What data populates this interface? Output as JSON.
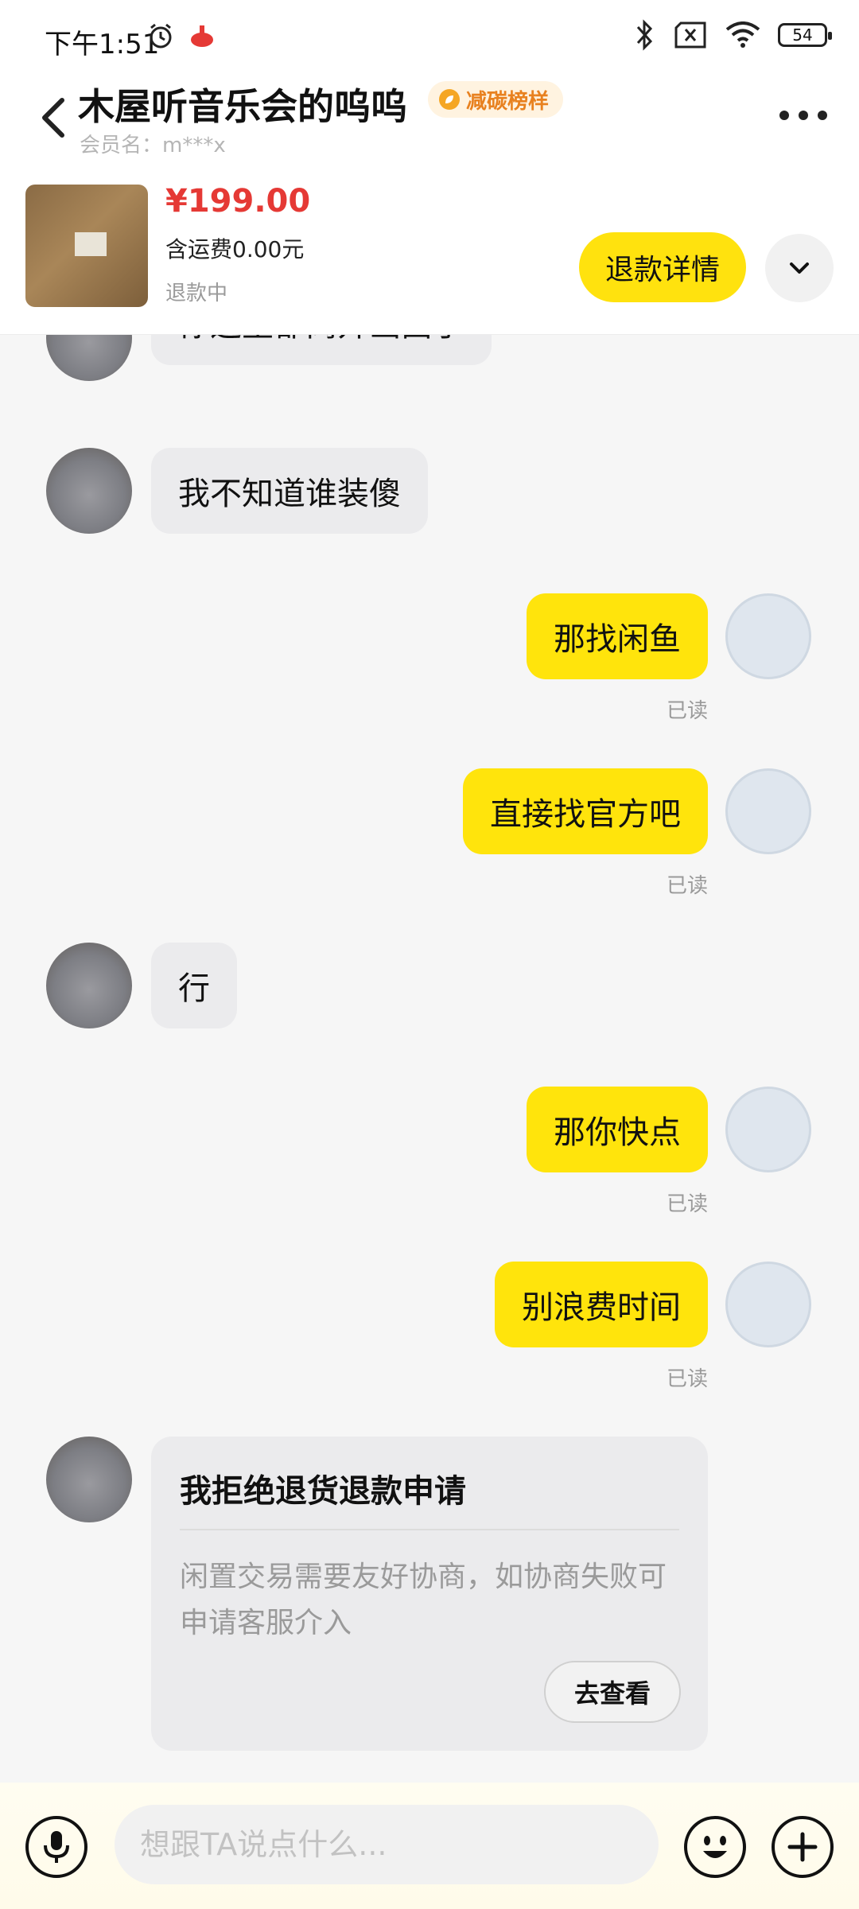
{
  "status_bar": {
    "time": "下午1:51",
    "battery": "54"
  },
  "header": {
    "seller_name": "木屋听音乐会的呜呜",
    "tag": "减碳榜样",
    "member_name": "会员名：m***x"
  },
  "order": {
    "price": "¥199.00",
    "shipping": "含运费0.00元",
    "status": "退款中",
    "refund_detail_button": "退款详情"
  },
  "messages": [
    {
      "side": "left",
      "text": "你这里都离开画面了"
    },
    {
      "side": "left",
      "text": "我不知道谁装傻"
    },
    {
      "side": "right",
      "text": "那找闲鱼",
      "read": "已读"
    },
    {
      "side": "right",
      "text": "直接找官方吧",
      "read": "已读"
    },
    {
      "side": "left",
      "text": "行"
    },
    {
      "side": "right",
      "text": "那你快点",
      "read": "已读"
    },
    {
      "side": "right",
      "text": "别浪费时间",
      "read": "已读"
    }
  ],
  "card": {
    "title": "我拒绝退货退款申请",
    "body": "闲置交易需要友好协商，如协商失败可申请客服介入",
    "button": "去查看"
  },
  "input": {
    "placeholder": "想跟TA说点什么..."
  },
  "colors": {
    "accent": "#ffe40c",
    "price": "#e53935",
    "tag": "#e8811f"
  }
}
